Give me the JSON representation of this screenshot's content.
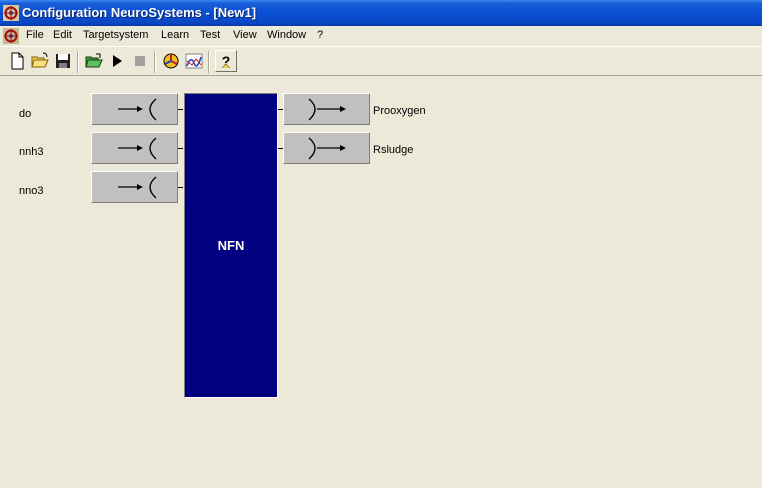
{
  "window": {
    "title": "Configuration NeuroSystems - [New1]"
  },
  "menu": {
    "items": [
      "File",
      "Edit",
      "Targetsystem",
      "Learn",
      "Test",
      "View",
      "Window",
      "?"
    ]
  },
  "toolbar": {
    "buttons": [
      "new-icon",
      "open-icon",
      "save-icon",
      "open-project-icon",
      "run-icon",
      "stop-icon",
      "rule-editor-icon",
      "plot-icon",
      "help-icon"
    ]
  },
  "inputs": [
    {
      "name": "do"
    },
    {
      "name": "nnh3"
    },
    {
      "name": "nno3"
    }
  ],
  "outputs": [
    {
      "name": "Prooxygen"
    },
    {
      "name": "Rsludge"
    }
  ],
  "block": {
    "label": "NFN",
    "color": "#000080"
  }
}
